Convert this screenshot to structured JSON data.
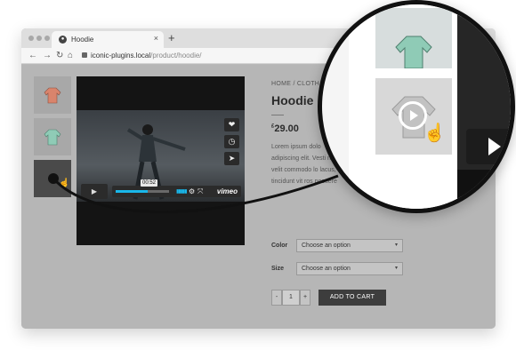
{
  "browser": {
    "tab_title": "Hoodie",
    "tab_close": "×",
    "new_tab": "+",
    "nav_back": "←",
    "nav_forward": "→",
    "nav_reload": "↻",
    "url_host": "iconic-plugins.local",
    "url_path": "/product/hoodie/",
    "nav_home": "⌂"
  },
  "gallery": {
    "thumbnails": [
      {
        "name": "hoodie-orange",
        "color": "#d9846c"
      },
      {
        "name": "hoodie-green",
        "color": "#8fcbb6"
      },
      {
        "name": "video-thumbnail",
        "color": "#4a4a4a"
      }
    ]
  },
  "video": {
    "time": "00:52",
    "progress": 0.6,
    "brand": "vimeo",
    "side_buttons": [
      "heart-icon",
      "clock-icon",
      "send-icon"
    ],
    "play_symbol": "▶",
    "volume_bars": "▮▮▮▮▮",
    "gear_symbol": "⚙",
    "expand_symbol": "⤧"
  },
  "product": {
    "breadcrumb": "HOME / CLOTH",
    "title": "Hoodie",
    "price_currency": "£",
    "price_value": "29.00",
    "description": "Lorem ipsum dolo adipiscing elit. Vesti nec velit commodo lo lacus, tincidunt vit ros posuere",
    "options": [
      {
        "label": "Color",
        "value": "Choose an option"
      },
      {
        "label": "Size",
        "value": "Choose an option"
      }
    ],
    "caret": "▾",
    "quantity": {
      "minus": "-",
      "value": "1",
      "plus": "+"
    },
    "add_to_cart": "ADD TO CART"
  },
  "colors": {
    "accent": "#19b7ea",
    "page_dim": "#b6b6b6",
    "cart_button": "#3d3d3d"
  }
}
